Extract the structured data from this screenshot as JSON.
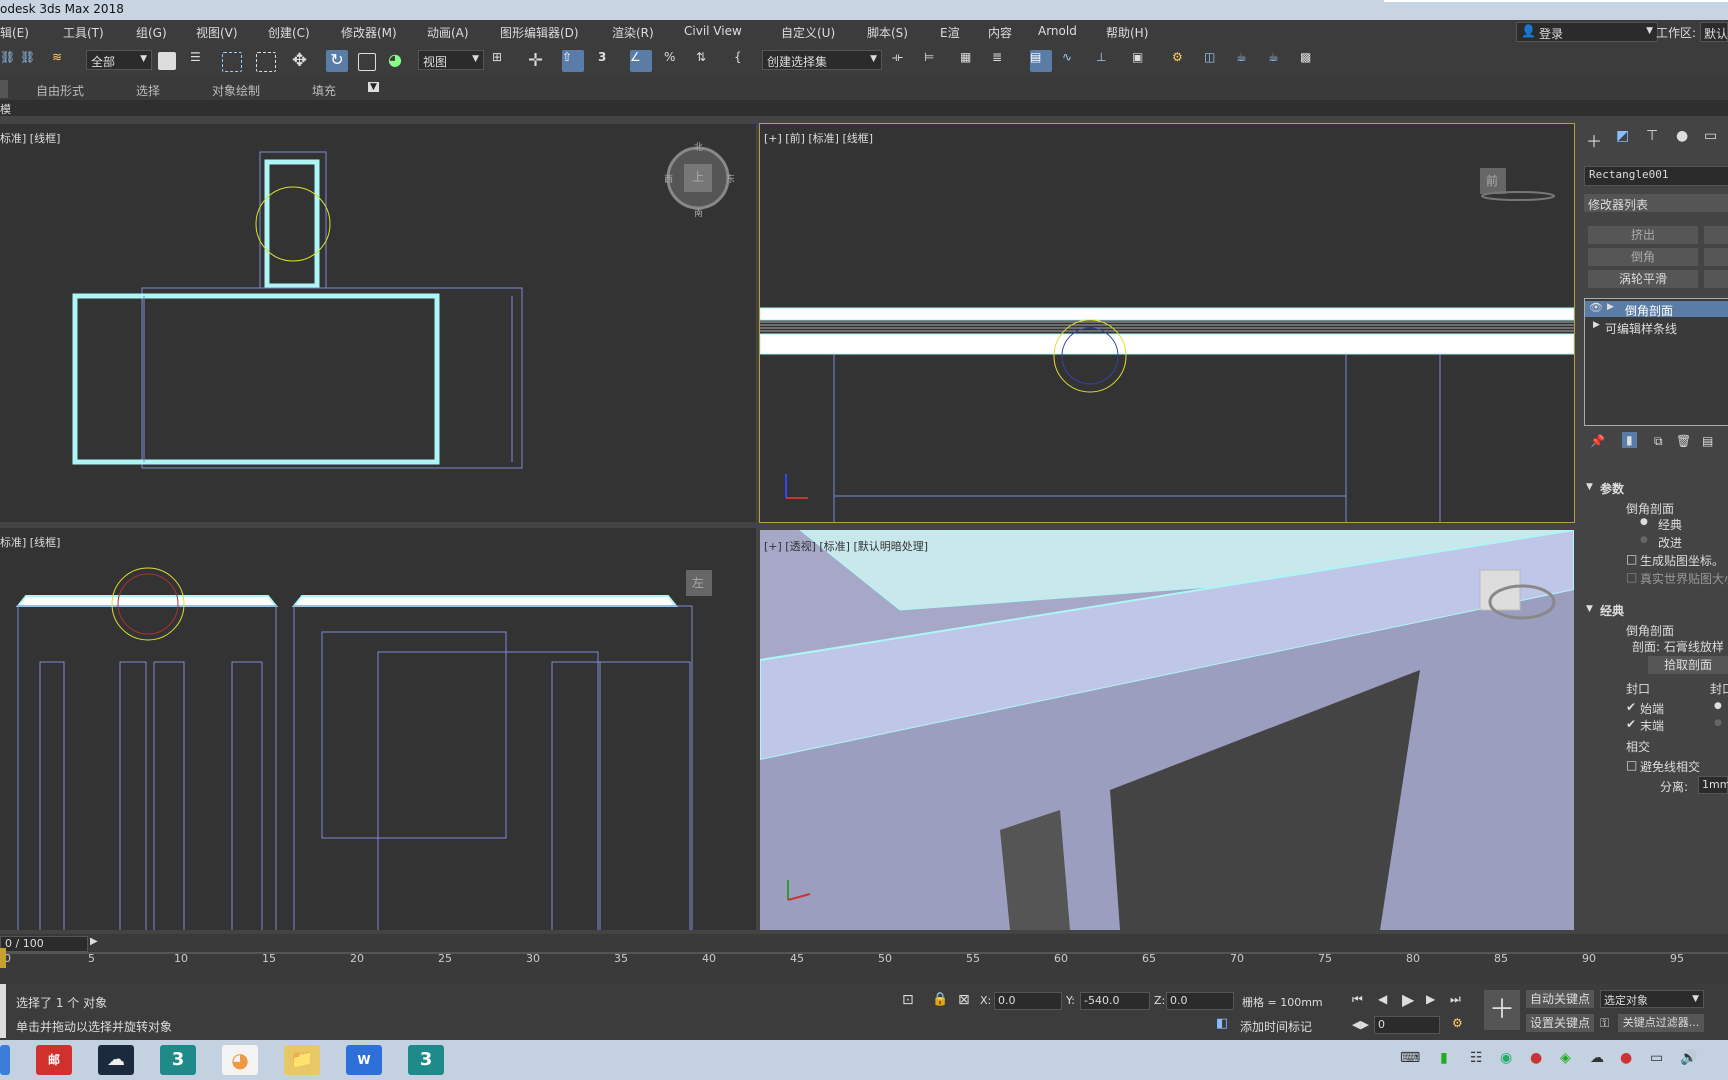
{
  "title": "odesk 3ds Max 2018",
  "menu": [
    "辑(E)",
    "工具(T)",
    "组(G)",
    "视图(V)",
    "创建(C)",
    "修改器(M)",
    "动画(A)",
    "图形编辑器(D)",
    "渲染(R)",
    "Civil View",
    "自定义(U)",
    "脚本(S)",
    "E渲",
    "内容",
    "Arnold",
    "帮助(H)"
  ],
  "login": "登录",
  "workspace": "工作区:",
  "workspace_value": "默认",
  "toolbar": {
    "filter": "全部",
    "viewref": "视图",
    "selset": "创建选择集"
  },
  "ribbon": [
    "自由形式",
    "选择",
    "对象绘制",
    "填充"
  ],
  "ribbon2": "模",
  "viewports": {
    "top_left": "标准] [线框]",
    "top_right": "[+] [前] [标准] [线框]",
    "bottom_left": "标准] [线框]",
    "bottom_right": "[+] [透视] [标准] [默认明暗处理]",
    "cube_top": "上",
    "cube_front": "前",
    "cube_left": "左",
    "compass": {
      "n": "北",
      "s": "南",
      "e": "东",
      "w": "西"
    }
  },
  "panel": {
    "object_name": "Rectangle001",
    "modifier_list": "修改器列表",
    "btn_extrude": "挤出",
    "btn_bevel": "倒角",
    "btn_turbosmooth": "涡轮平滑",
    "stack": [
      "倒角剖面",
      "可编辑样条线"
    ],
    "params_title": "参数",
    "bevel_profile": "倒角剖面",
    "radio_classic": "经典",
    "radio_improved": "改进",
    "gen_mapping": "生成贴图坐标。",
    "real_world": "真实世界贴图大小",
    "classic_title": "经典",
    "profile_label": "剖面: 石膏线放样",
    "pick_profile": "拾取剖面",
    "cap_title": "封口",
    "cap_title2": "封口",
    "cap_start": "始端",
    "cap_end": "末端",
    "intersect": "相交",
    "avoid_intersect": "避免线相交",
    "separation_label": "分离:",
    "separation_value": "1mm"
  },
  "timeline": {
    "frame": "0 / 100",
    "ticks": [
      "0",
      "5",
      "10",
      "15",
      "20",
      "25",
      "30",
      "35",
      "40",
      "45",
      "50",
      "55",
      "60",
      "65",
      "70",
      "75",
      "80",
      "85",
      "90",
      "95"
    ]
  },
  "status": {
    "selected": "选择了 1 个 对象",
    "hint": "单击并拖动以选择并旋转对象",
    "x_label": "X:",
    "x_value": "0.0",
    "y_label": "Y:",
    "y_value": "-540.0",
    "z_label": "Z:",
    "z_value": "0.0",
    "grid": "栅格 = 100mm",
    "add_time_tag": "添加时间标记",
    "auto_key": "自动关键点",
    "set_key": "设置关键点",
    "selected_obj": "选定对象",
    "key_filter": "关键点过滤器...",
    "frame_value": "0"
  }
}
